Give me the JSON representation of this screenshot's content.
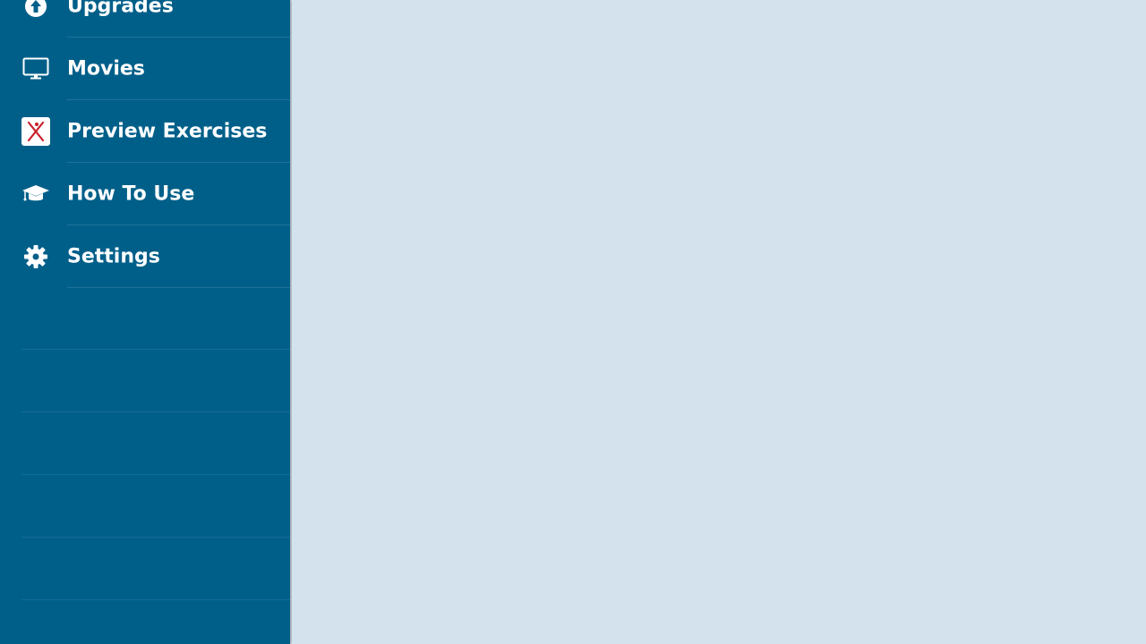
{
  "colors": {
    "sidebar_bg": "#005f89",
    "content_bg": "#d3e2ec",
    "label_text": "#ffffff"
  },
  "sidebar": {
    "items": [
      {
        "label": "Upgrades",
        "icon": "upgrade-arrow-icon"
      },
      {
        "label": "Movies",
        "icon": "monitor-icon"
      },
      {
        "label": "Preview Exercises",
        "icon": "exercise-logo-icon"
      },
      {
        "label": "How To Use",
        "icon": "graduation-cap-icon"
      },
      {
        "label": "Settings",
        "icon": "gear-icon"
      }
    ]
  }
}
